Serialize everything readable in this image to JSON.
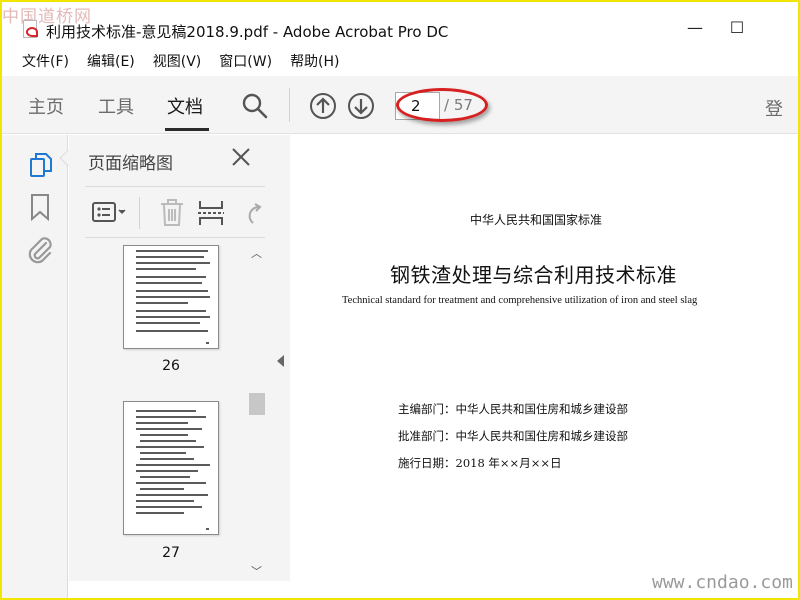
{
  "watermarks": {
    "top": "中国道桥网",
    "bottom": "www.cndao.com"
  },
  "window": {
    "title": "利用技术标准-意见稿2018.9.pdf - Adobe Acrobat Pro DC",
    "minimize": "—",
    "maximize": "☐"
  },
  "menu": [
    "文件(F)",
    "编辑(E)",
    "视图(V)",
    "窗口(W)",
    "帮助(H)"
  ],
  "toolbar": {
    "tabs": [
      "主页",
      "工具",
      "文档"
    ],
    "active_tab": "文档",
    "page_current": "2",
    "page_total": "/ 57",
    "signin": "登",
    "icons": [
      "search-icon",
      "page-up-icon",
      "page-down-icon"
    ]
  },
  "rail": {
    "icons": [
      "page-thumbnails-icon",
      "bookmark-icon",
      "attachment-icon"
    ]
  },
  "thumbnail_panel": {
    "title": "页面缩略图",
    "thumbnails": [
      {
        "label": "26"
      },
      {
        "label": "27"
      }
    ]
  },
  "document": {
    "standard_type": "中华人民共和国国家标准",
    "title": "钢铁渣处理与综合利用技术标准",
    "subtitle": "Technical standard for treatment and comprehensive utilization of iron and steel slag",
    "editor": "主编部门：中华人民共和国住房和城乡建设部",
    "approver": "批准部门：中华人民共和国住房和城乡建设部",
    "effective_date": "施行日期：2018 年××月××日"
  },
  "colors": {
    "annotation_ellipse": "#d72020",
    "frame": "#f2e600"
  }
}
